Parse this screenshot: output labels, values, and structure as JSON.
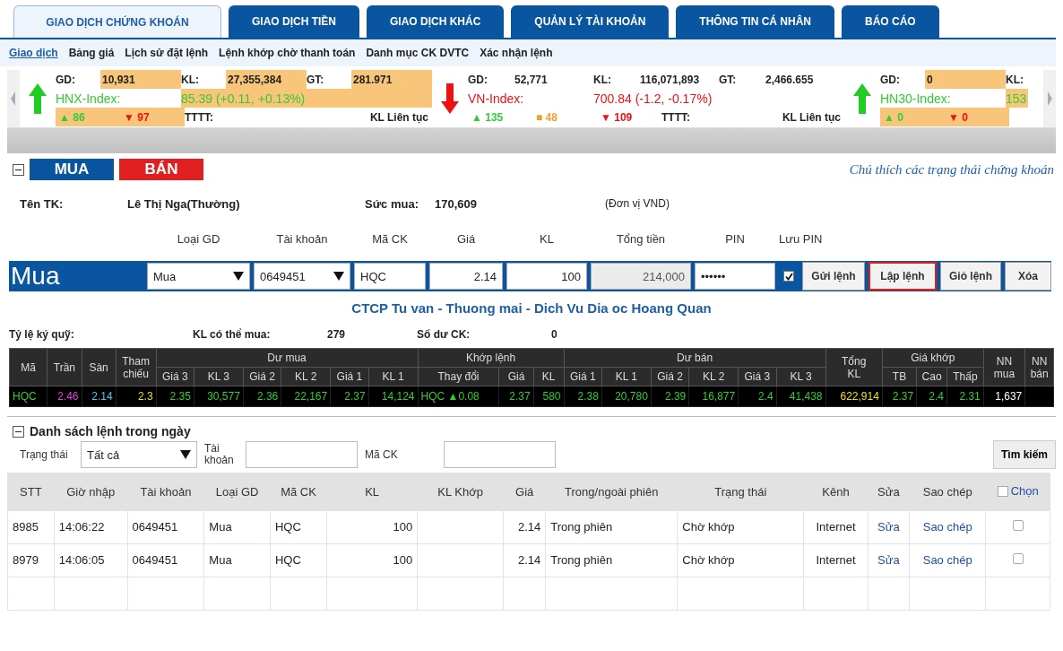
{
  "main_tabs": [
    {
      "label": "GIAO DỊCH CHỨNG KHOÁN",
      "selected": true
    },
    {
      "label": "GIAO DỊCH TIỀN",
      "selected": false
    },
    {
      "label": "GIAO DỊCH KHÁC",
      "selected": false
    },
    {
      "label": "QUẢN LÝ TÀI KHOẢN",
      "selected": false
    },
    {
      "label": "THÔNG TIN CÁ NHÂN",
      "selected": false
    },
    {
      "label": "BÁO CÁO",
      "selected": false
    }
  ],
  "sub_nav": [
    {
      "label": "Giao dịch",
      "selected": true
    },
    {
      "label": "Bảng giá",
      "selected": false
    },
    {
      "label": "Lịch sử đặt lệnh",
      "selected": false
    },
    {
      "label": "Lệnh khớp chờ thanh toán",
      "selected": false
    },
    {
      "label": "Danh mục CK DVTC",
      "selected": false
    },
    {
      "label": "Xác nhận lệnh",
      "selected": false
    }
  ],
  "ticker": [
    {
      "rising": true,
      "highlighted": true,
      "stats": [
        {
          "label": "GD:",
          "value": "10,931"
        },
        {
          "label": "KL:",
          "value": "27,355,384"
        },
        {
          "label": "GT:",
          "value": "281.971"
        }
      ],
      "name": "HNX-Index:",
      "value": "85.39 (+0.11, +0.13%)",
      "counts": [
        {
          "kind": "up",
          "text": "▲ 86"
        },
        {
          "kind": "down",
          "text": "▼ 97"
        }
      ],
      "footer": [
        "TTTT:",
        "KL Liên tục"
      ]
    },
    {
      "rising": false,
      "highlighted": false,
      "stats": [
        {
          "label": "GD:",
          "value": "52,771"
        },
        {
          "label": "KL:",
          "value": "116,071,893"
        },
        {
          "label": "GT:",
          "value": "2,466.655"
        }
      ],
      "name": "VN-Index:",
      "value": "700.84 (-1.2, -0.17%)",
      "counts": [
        {
          "kind": "up",
          "text": "▲ 135"
        },
        {
          "kind": "flat",
          "text": "■ 48"
        },
        {
          "kind": "down",
          "text": "▼ 109"
        }
      ],
      "footer": [
        "TTTT:",
        "KL Liên tục"
      ]
    },
    {
      "rising": true,
      "highlighted": true,
      "stats": [
        {
          "label": "GD:",
          "value": "0"
        },
        {
          "label": "KL:"
        }
      ],
      "name": "HN30-Index:",
      "value": "153",
      "counts": [
        {
          "kind": "up",
          "text": "▲ 0"
        },
        {
          "kind": "down",
          "text": "▼ 0"
        }
      ]
    }
  ],
  "order_panel": {
    "side_tabs": [
      {
        "label": "MUA",
        "kind": "buy"
      },
      {
        "label": "BÁN",
        "kind": "sell"
      }
    ],
    "legend_link": "Chú thích các trạng thái chứng khoán",
    "account_label": "Tên TK:",
    "account_name": "Lê Thị Nga(Thường)",
    "buying_power_label": "Sức mua:",
    "buying_power": "170,609",
    "unit": "(Đơn vị VND)",
    "side": "Mua",
    "fields": [
      {
        "label": "Loại GD",
        "kind": "select",
        "value": "Mua"
      },
      {
        "label": "Tài khoản",
        "kind": "select",
        "value": "0649451"
      },
      {
        "label": "Mã CK",
        "kind": "text",
        "value": "HQC"
      },
      {
        "label": "Giá",
        "kind": "number",
        "value": "2.14"
      },
      {
        "label": "KL",
        "kind": "number",
        "value": "100"
      },
      {
        "label": "Tổng tiền",
        "kind": "readonly",
        "value": "214,000"
      },
      {
        "label": "PIN",
        "kind": "text",
        "value": "••••••"
      },
      {
        "label": "Lưu PIN",
        "kind": "checkbox",
        "checked": true
      }
    ],
    "buttons": [
      {
        "label": "Gửi lệnh",
        "highlighted": false
      },
      {
        "label": "Lập lệnh",
        "highlighted": true
      },
      {
        "label": "Giỏ lệnh",
        "highlighted": false
      },
      {
        "label": "Xóa",
        "highlighted": false
      }
    ],
    "company": "CTCP Tu van - Thuong mai - Dich Vu Dia oc Hoang Quan",
    "stats": [
      {
        "label": "Tỷ lệ ký quỹ:"
      },
      {
        "label": "KL có thể mua:",
        "value": "279"
      },
      {
        "label": "Số dư CK:",
        "value": "0"
      }
    ]
  },
  "market": {
    "header": [
      {
        "label": "Mã"
      },
      {
        "label": "Trần"
      },
      {
        "label": "Sàn"
      },
      {
        "label": "Tham chiếu"
      },
      {
        "label": "Dư mua",
        "subheads": [
          {
            "label": "Giá 3"
          },
          {
            "label": "KL 3"
          },
          {
            "label": "Giá 2"
          },
          {
            "label": "KL 2"
          },
          {
            "label": "Giá 1"
          },
          {
            "label": "KL 1"
          }
        ]
      },
      {
        "label": "Khớp lệnh",
        "subheads": [
          {
            "label": "Thay đổi"
          },
          {
            "label": "Giá"
          },
          {
            "label": "KL"
          }
        ]
      },
      {
        "label": "Dư bán",
        "subheads": [
          {
            "label": "Giá 1"
          },
          {
            "label": "KL 1"
          },
          {
            "label": "Giá 2"
          },
          {
            "label": "KL 2"
          },
          {
            "label": "Giá 3"
          },
          {
            "label": "KL 3"
          }
        ]
      },
      {
        "label": "Tổng KL"
      },
      {
        "label": "Giá khớp",
        "subheads": [
          {
            "label": "TB"
          },
          {
            "label": "Cao"
          },
          {
            "label": "Thấp"
          }
        ]
      },
      {
        "label": "NN mua"
      },
      {
        "label": "NN bán"
      }
    ],
    "rows": [
      {
        "cells": [
          {
            "text": "HQC",
            "kind": "up"
          },
          {
            "text": "2.46",
            "kind": "ceiling"
          },
          {
            "text": "2.14",
            "kind": "floor"
          },
          {
            "text": "2.3",
            "kind": "reference"
          },
          {
            "text": "2.35",
            "kind": "up"
          },
          {
            "text": "30,577",
            "kind": "up"
          },
          {
            "text": "2.36",
            "kind": "up"
          },
          {
            "text": "22,167",
            "kind": "up"
          },
          {
            "text": "2.37",
            "kind": "up"
          },
          {
            "text": "14,124",
            "kind": "up"
          },
          {
            "text": "HQC ▲0.08",
            "kind": "up"
          },
          {
            "text": "2.37",
            "kind": "up"
          },
          {
            "text": "580",
            "kind": "up"
          },
          {
            "text": "2.38",
            "kind": "up"
          },
          {
            "text": "20,780",
            "kind": "up"
          },
          {
            "text": "2.39",
            "kind": "up"
          },
          {
            "text": "16,877",
            "kind": "up"
          },
          {
            "text": "2.4",
            "kind": "up"
          },
          {
            "text": "41,438",
            "kind": "up"
          },
          {
            "text": "622,914",
            "kind": "reference"
          },
          {
            "text": "2.37",
            "kind": "up"
          },
          {
            "text": "2.4",
            "kind": "up"
          },
          {
            "text": "2.31",
            "kind": "up"
          },
          {
            "text": "1,637",
            "kind": "plain"
          }
        ]
      }
    ]
  },
  "orders": {
    "title": "Danh sách lệnh trong ngày",
    "filters": [
      {
        "label": "Trạng thái",
        "kind": "select",
        "value": "Tất cả"
      },
      {
        "label": "Tài khoản",
        "kind": "text"
      },
      {
        "label": "Mã CK",
        "kind": "text"
      }
    ],
    "search_button": "Tìm kiếm",
    "columns": [
      "STT",
      "Giờ nhập",
      "Tài khoản",
      "Loại GD",
      "Mã CK",
      "KL",
      "KL Khớp",
      "Giá",
      "Trong/ngoài phiên",
      "Trạng thái",
      "Kênh",
      "Sửa",
      "Sao chép"
    ],
    "select_label": "Chọn",
    "select_all_checked": false,
    "rows": [
      {
        "stt": "8985",
        "time": "14:06:22",
        "account": "0649451",
        "type": "Mua",
        "symbol": "HQC",
        "qty": "100",
        "price": "2.14",
        "session": "Trong phiên",
        "status": "Chờ khớp",
        "channel": "Internet",
        "edit": "Sửa",
        "copy": "Sao chép",
        "checked": false
      },
      {
        "stt": "8979",
        "time": "14:06:05",
        "account": "0649451",
        "type": "Mua",
        "symbol": "HQC",
        "qty": "100",
        "price": "2.14",
        "session": "Trong phiên",
        "status": "Chờ khớp",
        "channel": "Internet",
        "edit": "Sửa",
        "copy": "Sao chép",
        "checked": false
      }
    ]
  }
}
